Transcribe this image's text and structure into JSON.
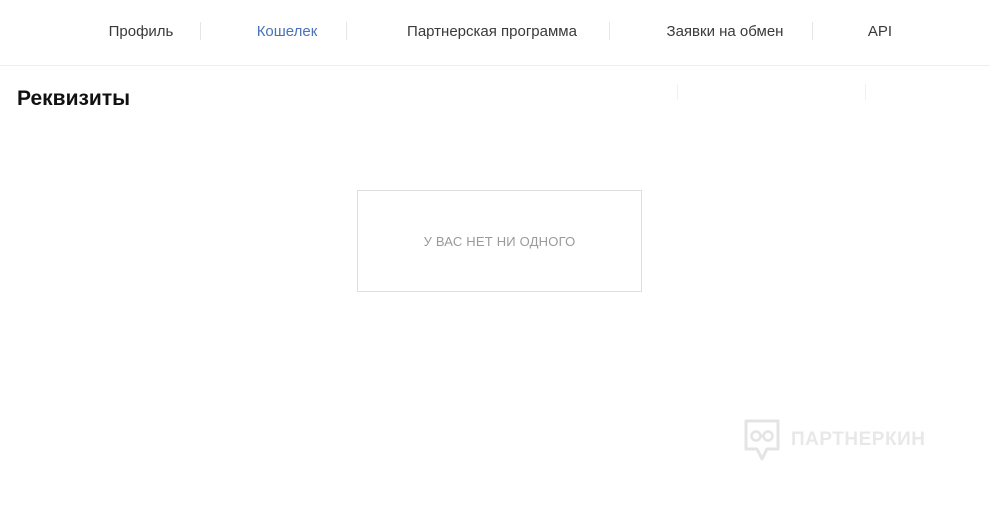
{
  "nav": {
    "tabs": [
      {
        "label": "Профиль",
        "active": false
      },
      {
        "label": "Кошелек",
        "active": true
      },
      {
        "label": "Партнерская программа",
        "active": false
      },
      {
        "label": "Заявки на обмен",
        "active": false
      },
      {
        "label": "API",
        "active": false
      }
    ]
  },
  "page": {
    "title": "Реквизиты"
  },
  "empty_state": {
    "message": "У ВАС НЕТ НИ ОДНОГО"
  },
  "watermark": {
    "brand": "ПАРТНЕРКИН",
    "icon": "speech-bubble-glasses-icon"
  },
  "colors": {
    "active_tab": "#4a72b8",
    "text": "#3a3a3a",
    "title": "#111111",
    "empty_text": "#9a9a9a",
    "border": "#dedede"
  }
}
